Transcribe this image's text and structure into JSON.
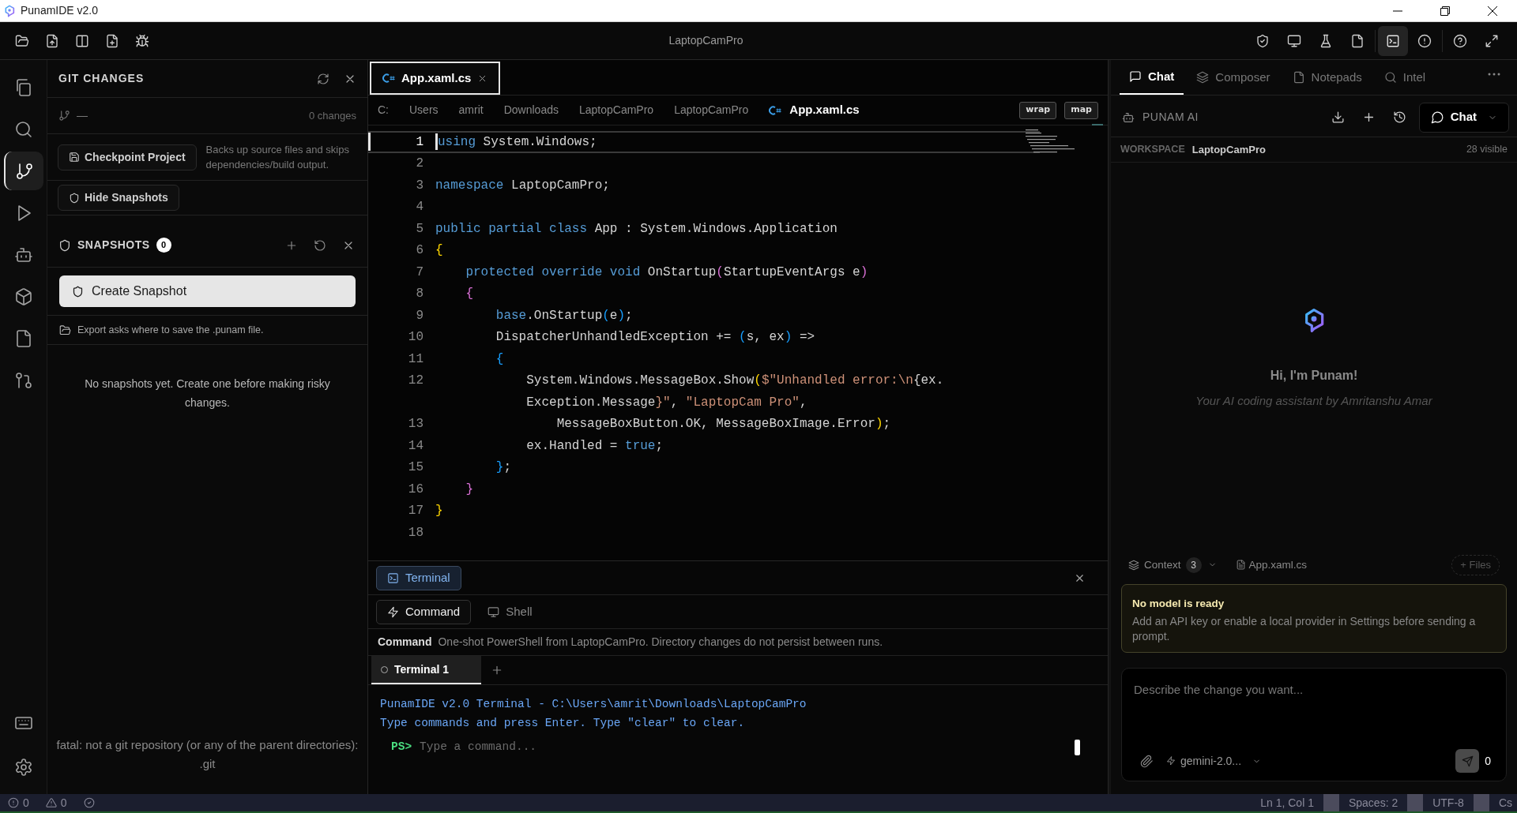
{
  "window": {
    "title": "PunamIDE v2.0"
  },
  "toolbar": {
    "project": "LaptopCamPro",
    "left_tools": [
      {
        "kind": "folder"
      },
      {
        "kind": "file-up"
      },
      {
        "kind": "columns"
      },
      {
        "kind": "file-plus"
      },
      {
        "kind": "bug"
      }
    ],
    "tool_groups": [
      [
        {
          "kind": "shield-check",
          "selected": false
        },
        {
          "kind": "monitor",
          "selected": false
        },
        {
          "kind": "flask",
          "selected": false
        },
        {
          "kind": "file",
          "selected": false
        }
      ],
      [
        {
          "kind": "terminal",
          "selected": true
        },
        {
          "kind": "alert",
          "selected": false
        }
      ],
      [
        {
          "kind": "help",
          "selected": false
        },
        {
          "kind": "expand",
          "selected": false
        }
      ]
    ]
  },
  "activity_bar": {
    "items": [
      {
        "kind": "files",
        "selected": false
      },
      {
        "kind": "search",
        "selected": false
      },
      {
        "kind": "git",
        "selected": true
      },
      {
        "kind": "play",
        "selected": false
      },
      {
        "kind": "bot",
        "selected": false
      },
      {
        "kind": "box",
        "selected": false
      },
      {
        "kind": "file",
        "selected": false
      },
      {
        "kind": "pull",
        "selected": false
      }
    ],
    "bottom": [
      {
        "kind": "keyboard"
      },
      {
        "kind": "settings"
      }
    ]
  },
  "git_panel": {
    "title": "GIT CHANGES",
    "branch": "—",
    "changes": "0 changes",
    "checkpoint_button": "Checkpoint Project",
    "checkpoint_note": "Backs up source files and skips dependencies/build output.",
    "hide_button": "Hide Snapshots",
    "snapshots_title": "SNAPSHOTS",
    "snapshots_count": "0",
    "create_button": "Create Snapshot",
    "export_note": "Export asks where to save the .punam file.",
    "empty_message": "No snapshots yet. Create one before making risky changes.",
    "error": "fatal: not a git repository (or any of the parent directories): .git"
  },
  "editor": {
    "tabs": [
      {
        "label": "App.xaml.cs",
        "selected": true
      }
    ],
    "breadcrumb": [
      {
        "label": "C:",
        "kind": "folder"
      },
      {
        "label": "Users",
        "kind": "folder"
      },
      {
        "label": "amrit",
        "kind": "folder"
      },
      {
        "label": "Downloads",
        "kind": "folder"
      },
      {
        "label": "LaptopCamPro",
        "kind": "folder"
      },
      {
        "label": "LaptopCamPro",
        "kind": "folder"
      },
      {
        "label": "App.xaml.cs",
        "kind": "file"
      }
    ],
    "buttons": [
      "wrap",
      "map"
    ],
    "rows": [
      {
        "number": "1",
        "current": true,
        "tokens": [
          {
            "kind": "keyword",
            "text": "using"
          },
          {
            "kind": "plain",
            "text": " System.Windows;"
          }
        ]
      },
      {
        "number": "2",
        "current": false,
        "tokens": []
      },
      {
        "number": "3",
        "current": false,
        "tokens": [
          {
            "kind": "keyword",
            "text": "namespace"
          },
          {
            "kind": "plain",
            "text": " LaptopCamPro;"
          }
        ]
      },
      {
        "number": "4",
        "current": false,
        "tokens": []
      },
      {
        "number": "5",
        "current": false,
        "tokens": [
          {
            "kind": "keyword",
            "text": "public partial class"
          },
          {
            "kind": "plain",
            "text": " App : System.Windows.Application"
          }
        ]
      },
      {
        "number": "6",
        "current": false,
        "tokens": [
          {
            "kind": "bracket1",
            "text": "{"
          }
        ]
      },
      {
        "number": "7",
        "current": false,
        "tokens": [
          {
            "kind": "keyword",
            "text": "    protected override void"
          },
          {
            "kind": "plain",
            "text": " OnStartup"
          },
          {
            "kind": "bracket2",
            "text": "("
          },
          {
            "kind": "plain",
            "text": "StartupEventArgs e"
          },
          {
            "kind": "bracket2",
            "text": ")"
          }
        ]
      },
      {
        "number": "8",
        "current": false,
        "tokens": [
          {
            "kind": "bracket2",
            "text": "    {"
          }
        ]
      },
      {
        "number": "9",
        "current": false,
        "tokens": [
          {
            "kind": "keyword",
            "text": "        base"
          },
          {
            "kind": "plain",
            "text": ".OnStartup"
          },
          {
            "kind": "bracket3",
            "text": "("
          },
          {
            "kind": "plain",
            "text": "e"
          },
          {
            "kind": "bracket3",
            "text": ")"
          },
          {
            "kind": "plain",
            "text": ";"
          }
        ]
      },
      {
        "number": "10",
        "current": false,
        "tokens": [
          {
            "kind": "plain",
            "text": "        DispatcherUnhandledException += "
          },
          {
            "kind": "bracket3",
            "text": "("
          },
          {
            "kind": "plain",
            "text": "s, ex"
          },
          {
            "kind": "bracket3",
            "text": ")"
          },
          {
            "kind": "plain",
            "text": " =>"
          }
        ]
      },
      {
        "number": "11",
        "current": false,
        "tokens": [
          {
            "kind": "bracket3",
            "text": "        {"
          }
        ]
      },
      {
        "number": "12",
        "current": false,
        "tokens": [
          {
            "kind": "plain",
            "text": "            System.Windows.MessageBox.Show"
          },
          {
            "kind": "bracket1",
            "text": "("
          },
          {
            "kind": "string",
            "text": "$\"Unhandled error:\\n"
          },
          {
            "kind": "plain",
            "text": "{ex."
          }
        ]
      },
      {
        "current": false,
        "tokens": [
          {
            "kind": "plain",
            "text": "            Exception.Message"
          },
          {
            "kind": "string",
            "text": "}\""
          },
          {
            "kind": "plain",
            "text": ", "
          },
          {
            "kind": "string",
            "text": "\"LaptopCam Pro\""
          },
          {
            "kind": "plain",
            "text": ","
          }
        ]
      },
      {
        "number": "13",
        "current": false,
        "tokens": [
          {
            "kind": "plain",
            "text": "                MessageBoxButton.OK, MessageBoxImage.Error"
          },
          {
            "kind": "bracket1",
            "text": ")"
          },
          {
            "kind": "plain",
            "text": ";"
          }
        ]
      },
      {
        "number": "14",
        "current": false,
        "tokens": [
          {
            "kind": "plain",
            "text": "            ex.Handled = "
          },
          {
            "kind": "keyword",
            "text": "true"
          },
          {
            "kind": "plain",
            "text": ";"
          }
        ]
      },
      {
        "number": "15",
        "current": false,
        "tokens": [
          {
            "kind": "bracket3",
            "text": "        }"
          },
          {
            "kind": "plain",
            "text": ";"
          }
        ]
      },
      {
        "number": "16",
        "current": false,
        "tokens": [
          {
            "kind": "bracket2",
            "text": "    }"
          }
        ]
      },
      {
        "number": "17",
        "current": false,
        "tokens": [
          {
            "kind": "bracket1",
            "text": "}"
          }
        ]
      },
      {
        "number": "18",
        "current": false,
        "tokens": []
      }
    ]
  },
  "terminal": {
    "title": "Terminal",
    "modes": [
      {
        "label": "Command",
        "kind": "command",
        "selected": true
      },
      {
        "label": "Shell",
        "kind": "shell",
        "selected": false
      }
    ],
    "mode_name": "Command",
    "mode_note": "One-shot PowerShell from LaptopCamPro. Directory changes do not persist between runs.",
    "sessions": [
      {
        "label": "Terminal 1",
        "selected": true
      }
    ],
    "output": [
      "PunamIDE v2.0 Terminal - C:\\Users\\amrit\\Downloads\\LaptopCamPro",
      "Type commands and press Enter. Type \"clear\" to clear."
    ],
    "prompt": "PS>",
    "placeholder": "Type a command..."
  },
  "chat": {
    "tabs": [
      {
        "label": "Chat",
        "kind": "chat",
        "selected": true
      },
      {
        "label": "Composer",
        "kind": "layers",
        "selected": false
      },
      {
        "label": "Notepads",
        "kind": "file",
        "selected": false
      },
      {
        "label": "Intel",
        "kind": "search",
        "selected": false
      }
    ],
    "assistant_label": "PUNAM AI",
    "mode_button": "Chat",
    "workspace_label": "WORKSPACE",
    "workspace": "LaptopCamPro",
    "visible": "28 visible",
    "greeting": "Hi, I'm Punam!",
    "tagline": "Your AI coding assistant by Amritanshu Amar",
    "context_label": "Context",
    "context_count": "3",
    "context_file": "App.xaml.cs",
    "files_button": "+ Files",
    "warning": {
      "title": "No model is ready",
      "text": "Add an API key or enable a local provider in Settings before sending a prompt."
    },
    "input": {
      "placeholder": "Describe the change you want..."
    },
    "model": "gemini-2.0...",
    "send_count": "0"
  },
  "status_bar": {
    "errors": "0",
    "warnings": "0",
    "items": [
      "Ln 1, Col 1",
      "Spaces: 2",
      "UTF-8",
      "Cs"
    ]
  }
}
